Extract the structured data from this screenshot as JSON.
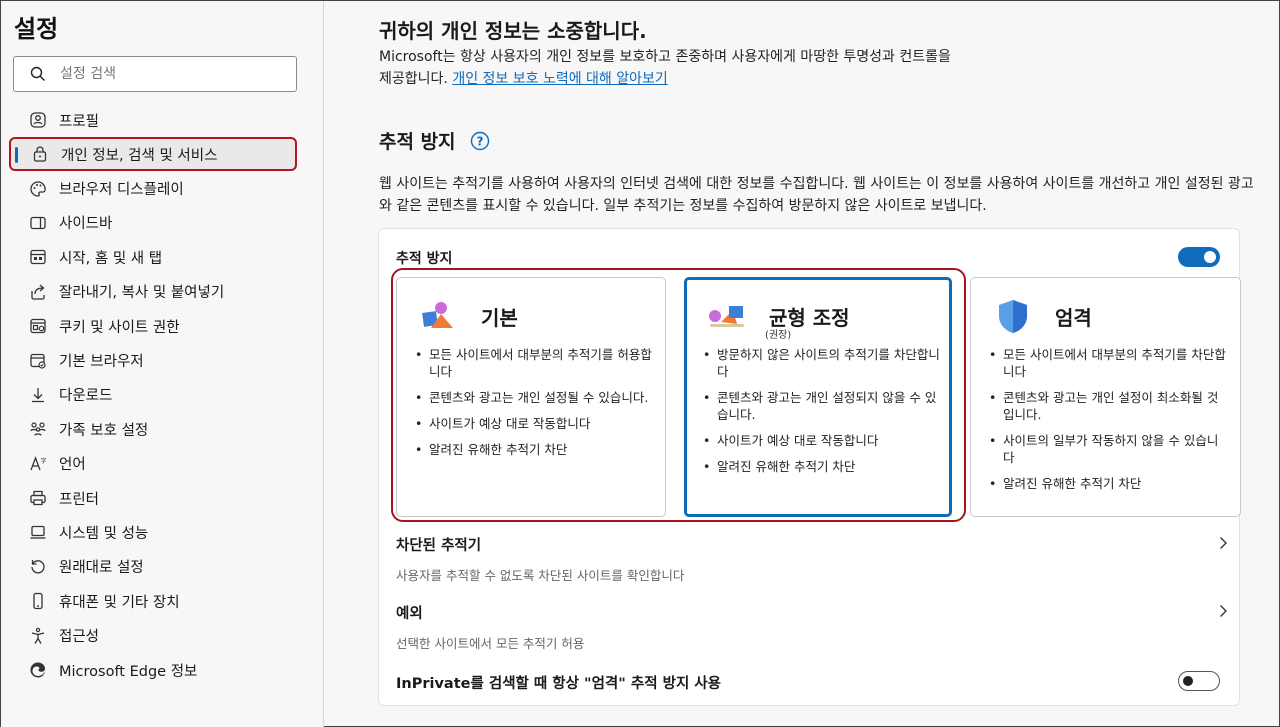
{
  "sidebar": {
    "title": "설정",
    "search_placeholder": "설정 검색",
    "items": [
      {
        "label": "프로필",
        "icon": "profile-icon"
      },
      {
        "label": "개인 정보, 검색 및 서비스",
        "icon": "lock-icon",
        "active": true
      },
      {
        "label": "브라우저 디스플레이",
        "icon": "palette-icon"
      },
      {
        "label": "사이드바",
        "icon": "sidebar-icon"
      },
      {
        "label": "시작, 홈 및 새 탭",
        "icon": "home-tab-icon"
      },
      {
        "label": "잘라내기, 복사 및 붙여넣기",
        "icon": "share-icon"
      },
      {
        "label": "쿠키 및 사이트 권한",
        "icon": "cookie-icon"
      },
      {
        "label": "기본 브라우저",
        "icon": "browser-icon"
      },
      {
        "label": "다운로드",
        "icon": "download-icon"
      },
      {
        "label": "가족 보호 설정",
        "icon": "family-icon"
      },
      {
        "label": "언어",
        "icon": "language-icon"
      },
      {
        "label": "프린터",
        "icon": "printer-icon"
      },
      {
        "label": "시스템 및 성능",
        "icon": "system-icon"
      },
      {
        "label": "원래대로 설정",
        "icon": "reset-icon"
      },
      {
        "label": "휴대폰 및 기타 장치",
        "icon": "phone-icon"
      },
      {
        "label": "접근성",
        "icon": "accessibility-icon"
      },
      {
        "label": "Microsoft Edge 정보",
        "icon": "edge-icon"
      }
    ]
  },
  "main": {
    "privacy_title": "귀하의 개인 정보는 소중합니다.",
    "privacy_desc": "Microsoft는 항상 사용자의 개인 정보를 보호하고 존중하며 사용자에게 마땅한 투명성과 컨트롤을 제공합니다.",
    "privacy_link": "개인 정보 보호 노력에 대해 알아보기",
    "section_title": "추적 방지",
    "section_desc": "웹 사이트는 추적기를 사용하여 사용자의 인터넷 검색에 대한 정보를 수집합니다. 웹 사이트는 이 정보를 사용하여 사이트를 개선하고 개인 설정된 광고와 같은 콘텐츠를 표시할 수 있습니다. 일부 추적기는 정보를 수집하여 방문하지 않은 사이트로 보냅니다.",
    "tp_label": "추적 방지",
    "tp_enabled": true,
    "options": {
      "basic": {
        "name": "기본",
        "bullets": [
          "모든 사이트에서 대부분의 추적기를 허용합니다",
          "콘텐츠와 광고는 개인 설정될 수 있습니다.",
          "사이트가 예상 대로 작동합니다",
          "알려진 유해한 추적기 차단"
        ]
      },
      "balanced": {
        "name": "균형 조정",
        "sub": "(권장)",
        "selected": true,
        "bullets": [
          "방문하지 않은 사이트의 추적기를 차단합니다",
          "콘텐츠와 광고는 개인 설정되지 않을 수 있습니다.",
          "사이트가 예상 대로 작동합니다",
          "알려진 유해한 추적기 차단"
        ]
      },
      "strict": {
        "name": "엄격",
        "bullets": [
          "모든 사이트에서 대부분의 추적기를 차단합니다",
          "콘텐츠와 광고는 개인 설정이 최소화될 것입니다.",
          "사이트의 일부가 작동하지 않을 수 있습니다",
          "알려진 유해한 추적기 차단"
        ]
      }
    },
    "blocked": {
      "title": "차단된 추적기",
      "sub": "사용자를 추적할 수 없도록 차단된 사이트를 확인합니다"
    },
    "exceptions": {
      "title": "예외",
      "sub": "선택한 사이트에서 모든 추적기 허용"
    },
    "inprivate": {
      "title": "InPrivate를 검색할 때 항상 \"엄격\" 추적 방지 사용",
      "enabled": false
    }
  }
}
